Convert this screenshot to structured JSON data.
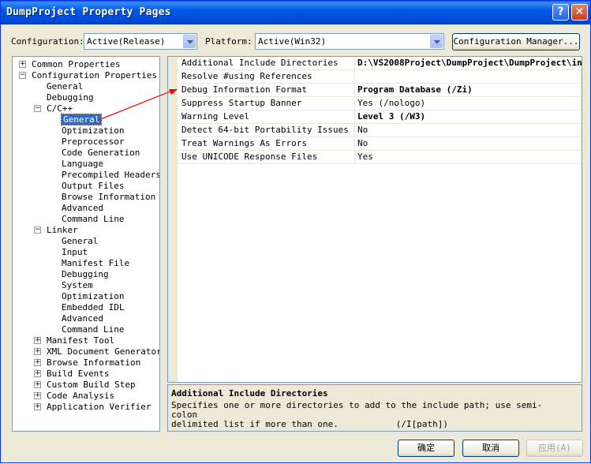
{
  "window": {
    "title": "DumpProject Property Pages"
  },
  "toolbar": {
    "configuration_label": "Configuration:",
    "configuration_value": "Active(Release)",
    "platform_label": "Platform:",
    "platform_value": "Active(Win32)",
    "config_manager_label": "Configuration Manager..."
  },
  "tree": {
    "common": "Common Properties",
    "config": "Configuration Properties",
    "general": "General",
    "debugging": "Debugging",
    "cpp": "C/C++",
    "cpp_items": [
      "General",
      "Optimization",
      "Preprocessor",
      "Code Generation",
      "Language",
      "Precompiled Headers",
      "Output Files",
      "Browse Information",
      "Advanced",
      "Command Line"
    ],
    "linker": "Linker",
    "linker_items": [
      "General",
      "Input",
      "Manifest File",
      "Debugging",
      "System",
      "Optimization",
      "Embedded IDL",
      "Advanced",
      "Command Line"
    ],
    "collapsed": [
      "Manifest Tool",
      "XML Document Generator",
      "Browse Information",
      "Build Events",
      "Custom Build Step",
      "Code Analysis",
      "Application Verifier"
    ]
  },
  "properties": [
    {
      "name": "Additional Include Directories",
      "value": "D:\\VS2008Project\\DumpProject\\DumpProject\\in"
    },
    {
      "name": "Resolve #using References",
      "value": ""
    },
    {
      "name": "Debug Information Format",
      "value": "Program Database (/Zi)"
    },
    {
      "name": "Suppress Startup Banner",
      "value": "Yes (/nologo)"
    },
    {
      "name": "Warning Level",
      "value": "Level 3 (/W3)"
    },
    {
      "name": "Detect 64-bit Portability Issues",
      "value": "No"
    },
    {
      "name": "Treat Warnings As Errors",
      "value": "No"
    },
    {
      "name": "Use UNICODE Response Files",
      "value": "Yes"
    }
  ],
  "description": {
    "title": "Additional Include Directories",
    "text_line1": "Specifies one or more directories to add to the include path; use semi-colon",
    "text_line2": "delimited list if more than one.           (/I[path])"
  },
  "buttons": {
    "ok": "确定",
    "cancel": "取消",
    "apply": "应用(A)"
  },
  "colors": {
    "titlebar": "#0058e6",
    "selection": "#316ac5",
    "annotation": "#ff0000"
  }
}
